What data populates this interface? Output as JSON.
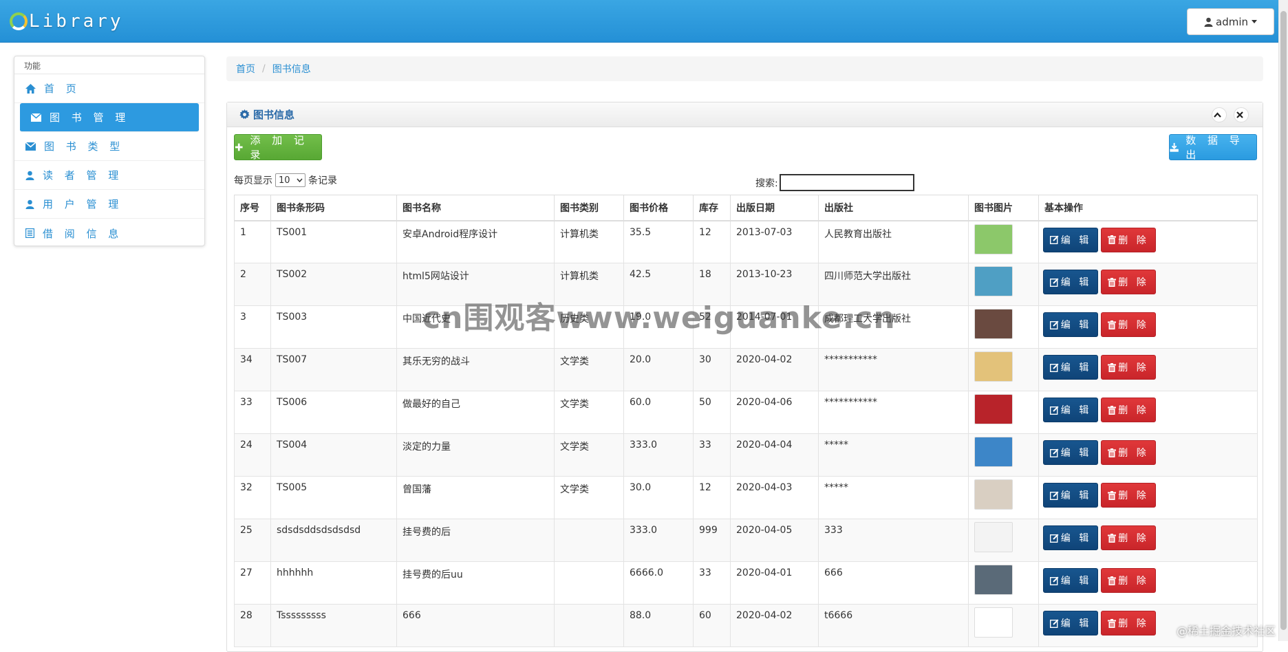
{
  "header": {
    "logo_text": "Library",
    "user": "admin"
  },
  "sidebar": {
    "title": "功能",
    "items": [
      {
        "label": "首 页",
        "icon": "home-icon",
        "active": false
      },
      {
        "label": "图 书 管 理",
        "icon": "envelope-icon",
        "active": true
      },
      {
        "label": "图 书 类 型",
        "icon": "envelope-icon",
        "active": false
      },
      {
        "label": "读 者 管 理",
        "icon": "user-icon",
        "active": false
      },
      {
        "label": "用 户 管 理",
        "icon": "user-icon",
        "active": false
      },
      {
        "label": "借 阅 信 息",
        "icon": "list-icon",
        "active": false
      }
    ]
  },
  "breadcrumb": {
    "home": "首页",
    "current": "图书信息"
  },
  "panel": {
    "title": "图书信息",
    "add_label": "添 加 记 录",
    "export_label": "数 据 导 出",
    "pagesize_prefix": "每页显示",
    "pagesize_value": "10",
    "pagesize_suffix": "条记录",
    "search_label": "搜索:",
    "search_value": ""
  },
  "table": {
    "headers": [
      "序号",
      "图书条形码",
      "图书名称",
      "图书类别",
      "图书价格",
      "库存",
      "出版日期",
      "出版社",
      "图书图片",
      "基本操作"
    ],
    "edit_label": "编 辑",
    "delete_label": "删 除",
    "rows": [
      {
        "id": "1",
        "code": "TS001",
        "name": "安卓Android程序设计",
        "category": "计算机类",
        "price": "35.5",
        "stock": "12",
        "date": "2013-07-03",
        "publisher": "人民教育出版社",
        "thumb": "#8cc86a"
      },
      {
        "id": "2",
        "code": "TS002",
        "name": "html5网站设计",
        "category": "计算机类",
        "price": "42.5",
        "stock": "18",
        "date": "2013-10-23",
        "publisher": "四川师范大学出版社",
        "thumb": "#4f9fc4"
      },
      {
        "id": "3",
        "code": "TS003",
        "name": "中国近代史",
        "category": "历史类",
        "price": "19.0",
        "stock": "52",
        "date": "2014-07-01",
        "publisher": "成都理工大学出版社",
        "thumb": "#6a4a40"
      },
      {
        "id": "34",
        "code": "TS007",
        "name": "其乐无穷的战斗",
        "category": "文学类",
        "price": "20.0",
        "stock": "30",
        "date": "2020-04-02",
        "publisher": "***********",
        "thumb": "#e3c27a"
      },
      {
        "id": "33",
        "code": "TS006",
        "name": "做最好的自己",
        "category": "文学类",
        "price": "60.0",
        "stock": "50",
        "date": "2020-04-06",
        "publisher": "***********",
        "thumb": "#b8232a"
      },
      {
        "id": "24",
        "code": "TS004",
        "name": "淡定的力量",
        "category": "文学类",
        "price": "333.0",
        "stock": "33",
        "date": "2020-04-04",
        "publisher": "*****",
        "thumb": "#3d86c8"
      },
      {
        "id": "32",
        "code": "TS005",
        "name": "曾国藩",
        "category": "文学类",
        "price": "30.0",
        "stock": "12",
        "date": "2020-04-03",
        "publisher": "*****",
        "thumb": "#d9cfc2"
      },
      {
        "id": "25",
        "code": "sdsdsddsdsdsdsd",
        "name": "挂号费的后",
        "category": "",
        "price": "333.0",
        "stock": "999",
        "date": "2020-04-05",
        "publisher": "333",
        "thumb": "#f3f3f3"
      },
      {
        "id": "27",
        "code": "hhhhhh",
        "name": "挂号费的后uu",
        "category": "",
        "price": "6666.0",
        "stock": "33",
        "date": "2020-04-01",
        "publisher": "666",
        "thumb": "#5a6a78"
      },
      {
        "id": "28",
        "code": "Tsssssssss",
        "name": "666",
        "category": "",
        "price": "88.0",
        "stock": "60",
        "date": "2020-04-02",
        "publisher": "t6666",
        "thumb": "#ffffff"
      }
    ]
  },
  "overlay": {
    "watermark": "cn围观客www.weiguanke.cn",
    "corner": "@稀土掘金技术社区"
  },
  "colors": {
    "brand": "#2d9ae0",
    "add": "#5cb85c",
    "edit": "#134d85",
    "delete": "#d9312f"
  }
}
